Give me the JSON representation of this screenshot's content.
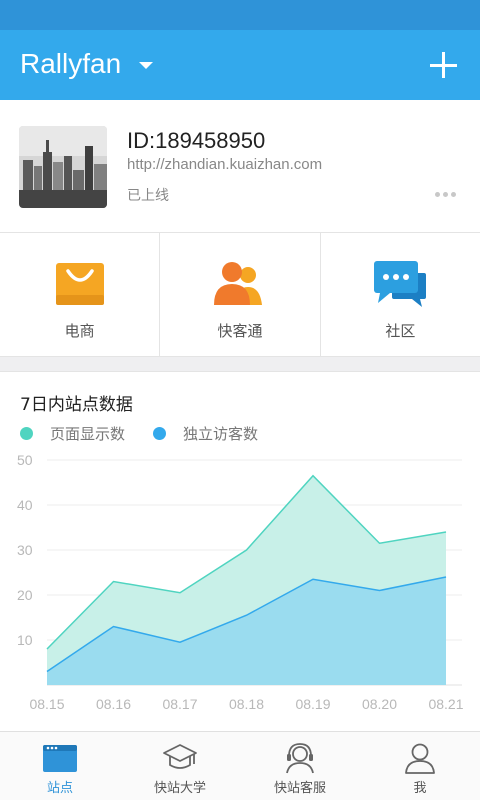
{
  "header": {
    "title": "Rallyfan",
    "add_icon": "plus-icon",
    "dropdown_icon": "caret-down-icon"
  },
  "site": {
    "id_text": "ID:189458950",
    "url": "http://zhandian.kuaizhan.com",
    "status": "已上线",
    "more_icon": "more-dots-icon"
  },
  "quick_actions": [
    {
      "label": "电商",
      "icon": "shopping-bag-icon",
      "color": "#f5a623"
    },
    {
      "label": "快客通",
      "icon": "users-icon",
      "color": "#f07a2c"
    },
    {
      "label": "社区",
      "icon": "chat-bubbles-icon",
      "color": "#2c9fe0"
    }
  ],
  "stats": {
    "title": "7日内站点数据",
    "legend": [
      {
        "name": "页面显示数",
        "color": "#4fd4c0"
      },
      {
        "name": "独立访客数",
        "color": "#33a9ec"
      }
    ]
  },
  "chart_data": {
    "type": "area",
    "x": [
      "08.15",
      "08.16",
      "08.17",
      "08.18",
      "08.19",
      "08.20",
      "08.21"
    ],
    "series": [
      {
        "name": "页面显示数",
        "values": [
          8,
          23,
          20.5,
          30,
          46.5,
          31.5,
          34
        ]
      },
      {
        "name": "独立访客数",
        "values": [
          3,
          13,
          9.5,
          15.5,
          23.5,
          21,
          24
        ]
      }
    ],
    "yticks": [
      50,
      40,
      30,
      20,
      10
    ],
    "ylim": [
      0,
      50
    ],
    "grid": true
  },
  "tabs": [
    {
      "label": "站点",
      "icon": "site-window-icon",
      "active": true
    },
    {
      "label": "快站大学",
      "icon": "graduation-cap-icon",
      "active": false
    },
    {
      "label": "快站客服",
      "icon": "headset-icon",
      "active": false
    },
    {
      "label": "我",
      "icon": "person-icon",
      "active": false
    }
  ],
  "colors": {
    "header": "#33a9ec",
    "status_bar": "#2f93d8",
    "active_tab": "#2f93d8"
  }
}
